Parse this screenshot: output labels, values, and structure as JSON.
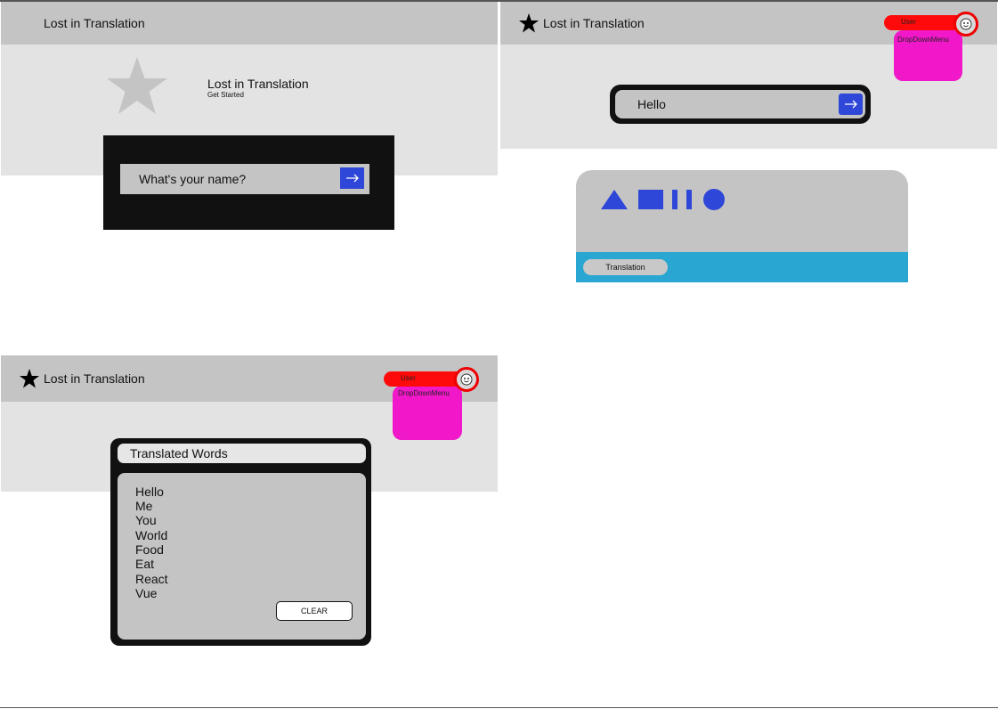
{
  "app": {
    "title": "Lost in Translation"
  },
  "landing": {
    "header_title": "Lost in Translation",
    "hero_title": "Lost in Translation",
    "hero_subtitle": "Get Started",
    "name_placeholder": "What's your name?"
  },
  "translate": {
    "header_title": "Lost in Translation",
    "user_label": "User",
    "dropdown_label": "DropDownMenu",
    "input_value": "Hello",
    "output_tab": "Translation"
  },
  "profile": {
    "header_title": "Lost in Translation",
    "user_label": "User",
    "dropdown_label": "DropDownMenu",
    "panel_title": "Translated Words",
    "words": [
      "Hello",
      "Me",
      "You",
      "World",
      "Food",
      "Eat",
      "React",
      "Vue"
    ],
    "clear_label": "CLEAR"
  },
  "colors": {
    "accent_blue": "#2e47d8",
    "user_red": "#ff0a0a",
    "dropdown_magenta": "#f018c8",
    "translation_bar": "#29a6d1"
  },
  "icons": {
    "star": "star-icon",
    "arrow": "arrow-right-icon",
    "avatar": "smiley-icon",
    "signs": [
      "triangle-sign",
      "square-sign",
      "bars-sign",
      "circle-sign"
    ]
  }
}
